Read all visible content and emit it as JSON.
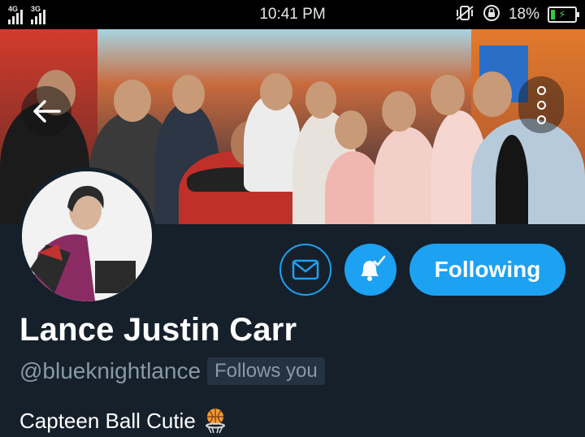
{
  "status_bar": {
    "network_1": "4G",
    "network_2": "3G",
    "time": "10:41 PM",
    "battery_percent": "18%",
    "battery_level": 0.18,
    "icons": [
      "signal-icon",
      "vibrate-mute-icon",
      "rotation-lock-icon",
      "battery-charging-icon"
    ]
  },
  "header": {
    "back_icon": "arrow-left-icon",
    "more_icon": "more-vertical-icon"
  },
  "profile": {
    "actions": {
      "message_icon": "envelope-icon",
      "notification_icon": "bell-check-icon",
      "following_label": "Following"
    },
    "display_name": "Lance Justin Carr",
    "handle": "@blueknightlance",
    "follows_you_label": "Follows you",
    "bio_text": "Capteen Ball Cutie",
    "bio_emoji": "basketball-hoop-icon"
  },
  "colors": {
    "background": "#15202b",
    "accent": "#1da1f2",
    "secondary_text": "#8899a6",
    "badge_bg": "#253341",
    "status_bar_bg": "#000000",
    "battery_green": "#2ecc40"
  }
}
